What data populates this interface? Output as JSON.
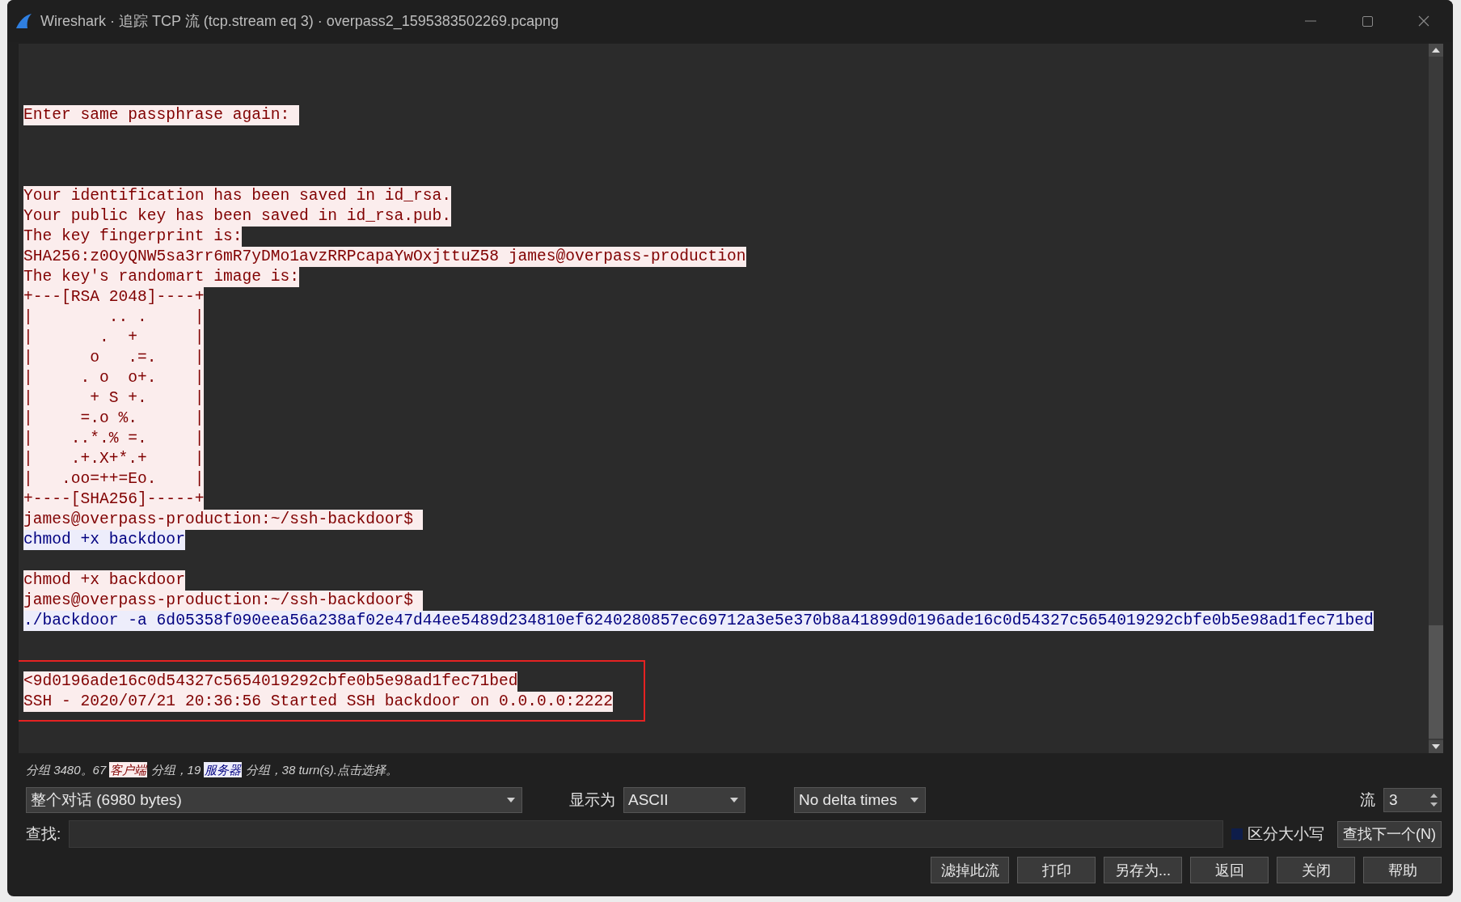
{
  "window": {
    "title": "Wireshark · 追踪 TCP 流 (tcp.stream eq 3) · overpass2_1595383502269.pcapng"
  },
  "stream": {
    "lines": [
      {
        "kind": "client",
        "text": "Enter same passphrase again: "
      },
      {
        "kind": "blank"
      },
      {
        "kind": "blank"
      },
      {
        "kind": "blank"
      },
      {
        "kind": "client",
        "text": "Your identification has been saved in id_rsa."
      },
      {
        "kind": "client",
        "text": "Your public key has been saved in id_rsa.pub."
      },
      {
        "kind": "client",
        "text": "The key fingerprint is:"
      },
      {
        "kind": "client",
        "text": "SHA256:z0OyQNW5sa3rr6mR7yDMo1avzRRPcapaYwOxjttuZ58 james@overpass-production"
      },
      {
        "kind": "client",
        "text": "The key's randomart image is:"
      },
      {
        "kind": "client",
        "text": "+---[RSA 2048]----+"
      },
      {
        "kind": "client",
        "text": "|        .. .     |"
      },
      {
        "kind": "client",
        "text": "|       .  +      |"
      },
      {
        "kind": "client",
        "text": "|      o   .=.    |"
      },
      {
        "kind": "client",
        "text": "|     . o  o+.    |"
      },
      {
        "kind": "client",
        "text": "|      + S +.     |"
      },
      {
        "kind": "client",
        "text": "|     =.o %.      |"
      },
      {
        "kind": "client",
        "text": "|    ..*.% =.     |"
      },
      {
        "kind": "client",
        "text": "|    .+.X+*.+     |"
      },
      {
        "kind": "client",
        "text": "|   .oo=++=Eo.    |"
      },
      {
        "kind": "client",
        "text": "+----[SHA256]-----+"
      },
      {
        "kind": "client",
        "text": "james@overpass-production:~/ssh-backdoor$ "
      },
      {
        "kind": "server",
        "text": "chmod +x backdoor"
      },
      {
        "kind": "blank"
      },
      {
        "kind": "client",
        "text": "chmod +x backdoor"
      },
      {
        "kind": "client",
        "text": "james@overpass-production:~/ssh-backdoor$ "
      },
      {
        "kind": "server",
        "text": "./backdoor -a 6d05358f090eea56a238af02e47d44ee5489d234810ef6240280857ec69712a3e5e370b8a41899d0196ade16c0d54327c5654019292cbfe0b5e98ad1fec71bed"
      },
      {
        "kind": "blank"
      },
      {
        "kind": "blank"
      },
      {
        "kind": "frame",
        "lines": [
          {
            "kind": "client",
            "text": "<9d0196ade16c0d54327c5654019292cbfe0b5e98ad1fec71bed"
          },
          {
            "kind": "client",
            "text": "SSH - 2020/07/21 20:36:56 Started SSH backdoor on 0.0.0.0:2222"
          }
        ]
      }
    ]
  },
  "status": {
    "prefix": "分组 3480。67 ",
    "client_label": "客户端",
    "middle": " 分组，19 ",
    "server_label": "服务器",
    "suffix": " 分组，38 turn(s).点击选择。"
  },
  "controls": {
    "conversation": "整个对话 (6980 bytes)",
    "show_as_label": "显示为",
    "show_as": "ASCII",
    "delta": "No delta times",
    "stream_label": "流",
    "stream": "3"
  },
  "find": {
    "label": "查找:",
    "case_label": "区分大小写",
    "case_checked": false,
    "next_button": "查找下一个(N)"
  },
  "buttons": [
    "滤掉此流",
    "打印",
    "另存为...",
    "返回",
    "关闭",
    "帮助"
  ]
}
